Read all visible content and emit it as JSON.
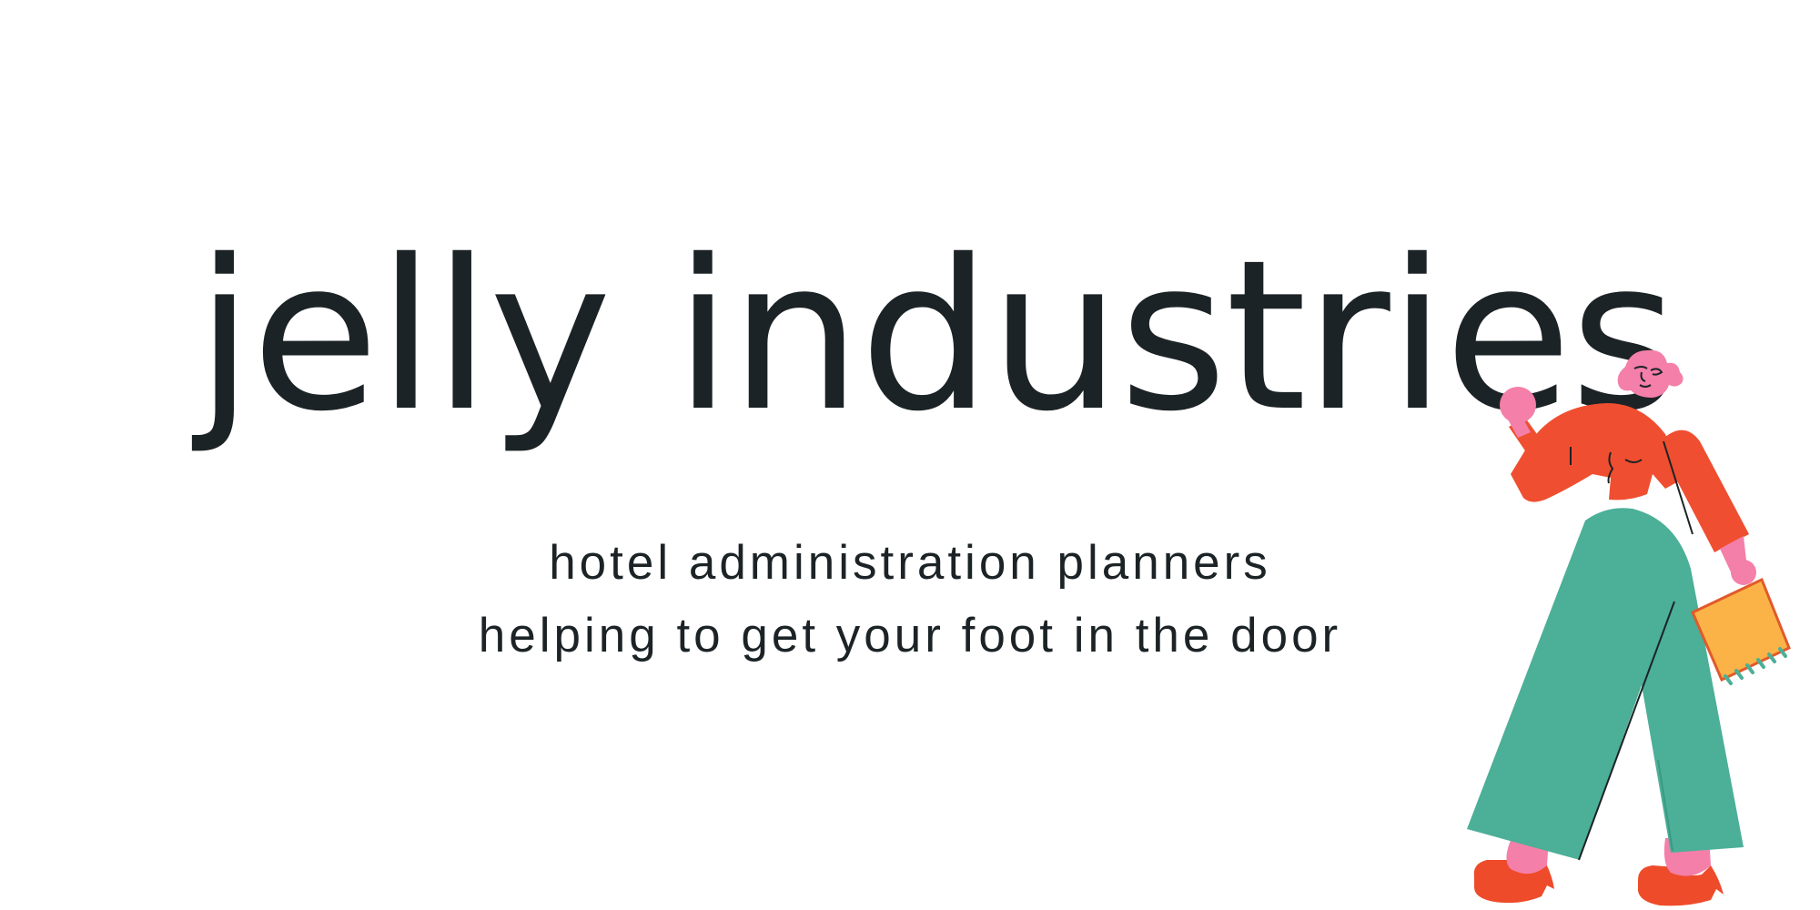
{
  "brand": {
    "name": "jelly industries"
  },
  "tagline": {
    "line1": "hotel administration planners",
    "line2": "helping to get your foot in the door"
  },
  "illustration": {
    "icon": "walking-woman-with-notebook-icon"
  },
  "colors": {
    "background": "#ffffff",
    "text": "#1c2326",
    "top": "#f04e30",
    "pants": "#4caf97",
    "skin": "#f47fa8",
    "notebook": "#fbb347",
    "shoes": "#ee4b2b"
  }
}
